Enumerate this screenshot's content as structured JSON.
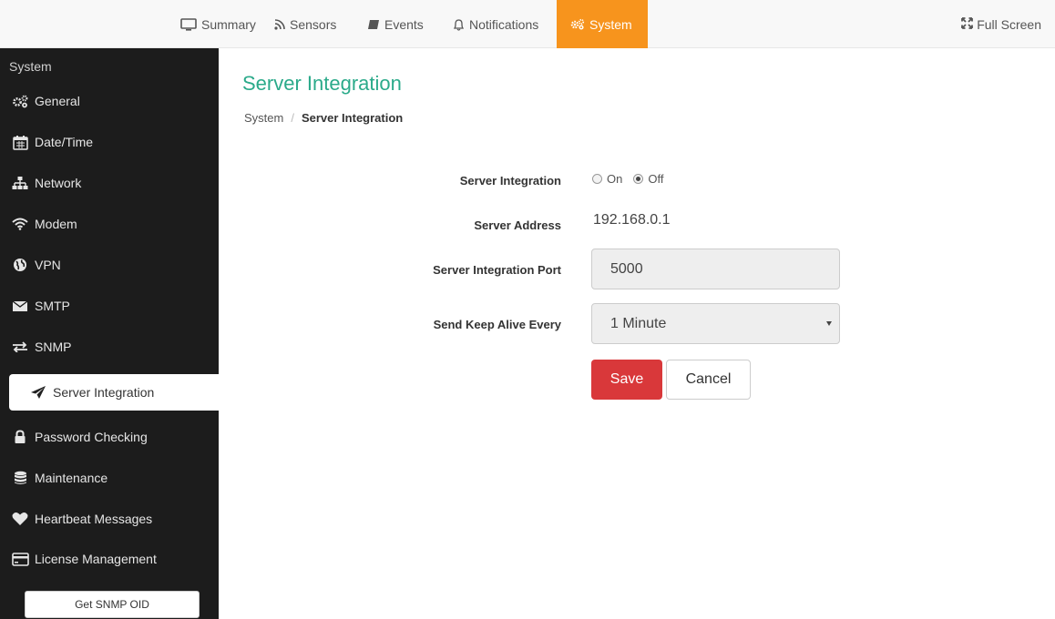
{
  "topnav": {
    "tabs": [
      {
        "label": "Summary",
        "icon": "monitor-icon"
      },
      {
        "label": "Sensors",
        "icon": "rss-icon"
      },
      {
        "label": "Events",
        "icon": "book-icon"
      },
      {
        "label": "Notifications",
        "icon": "bell-icon"
      },
      {
        "label": "System",
        "icon": "gears-icon",
        "active": true
      }
    ],
    "fullscreen_label": "Full Screen"
  },
  "sidebar": {
    "title": "System",
    "items": [
      {
        "label": "General",
        "icon": "gears-icon"
      },
      {
        "label": "Date/Time",
        "icon": "calendar-icon"
      },
      {
        "label": "Network",
        "icon": "sitemap-icon"
      },
      {
        "label": "Modem",
        "icon": "wifi-icon"
      },
      {
        "label": "VPN",
        "icon": "globe-icon"
      },
      {
        "label": "SMTP",
        "icon": "envelope-icon"
      },
      {
        "label": "SNMP",
        "icon": "exchange-icon"
      },
      {
        "label": "Server Integration",
        "icon": "paper-plane-icon",
        "active": true
      },
      {
        "label": "Password Checking",
        "icon": "lock-icon"
      },
      {
        "label": "Maintenance",
        "icon": "database-icon"
      },
      {
        "label": "Heartbeat Messages",
        "icon": "heart-icon"
      },
      {
        "label": "License Management",
        "icon": "credit-card-icon"
      }
    ],
    "snmp_button": "Get SNMP OID"
  },
  "main": {
    "title": "Server Integration",
    "breadcrumb": {
      "parent": "System",
      "separator": "/",
      "current": "Server Integration"
    },
    "form": {
      "integration_label": "Server Integration",
      "option_on": "On",
      "option_off": "Off",
      "selected": "Off",
      "address_label": "Server Address",
      "address_value": "192.168.0.1",
      "port_label": "Server Integration Port",
      "port_value": "5000",
      "keepalive_label": "Send Keep Alive Every",
      "keepalive_value": "1 Minute",
      "save_label": "Save",
      "cancel_label": "Cancel"
    }
  },
  "colors": {
    "accent_orange": "#f7941d",
    "title_green": "#2baa8a",
    "save_red": "#d9383a",
    "sidebar_bg": "#1c1c1c"
  }
}
